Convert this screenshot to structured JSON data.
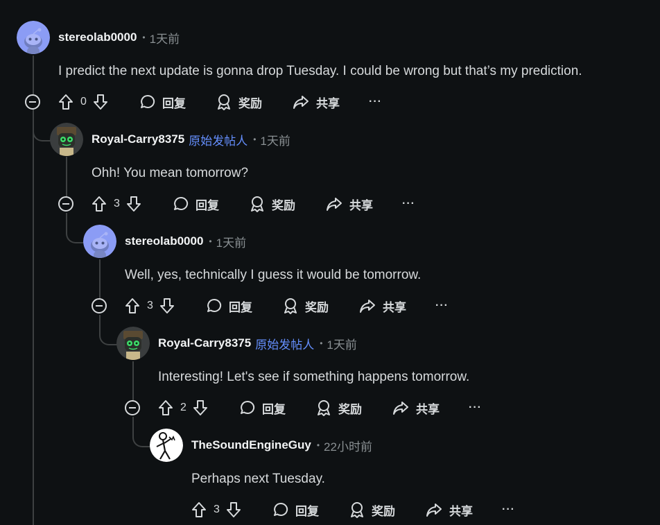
{
  "labels": {
    "reply": "回复",
    "award": "奖励",
    "share": "共享",
    "more": "···"
  },
  "colors": {
    "background": "#0e1113",
    "op_badge": "#648efc",
    "thread_line": "#3e4142",
    "text": "#d7dadc",
    "muted": "#8a9093"
  },
  "comments": [
    {
      "username": "stereolab0000",
      "op_badge": "",
      "time": "1天前",
      "body": "I predict the next update is gonna drop Tuesday. I could be wrong but that’s my prediction.",
      "votes": "0",
      "avatar": "snoo-default-avatar"
    },
    {
      "username": "Royal-Carry8375",
      "op_badge": "原始发帖人",
      "time": "1天前",
      "body": "Ohh! You mean tomorrow?",
      "votes": "3",
      "avatar": "robot-green-eyes-avatar"
    },
    {
      "username": "stereolab0000",
      "op_badge": "",
      "time": "1天前",
      "body": "Well, yes, technically I guess it would be tomorrow.",
      "votes": "3",
      "avatar": "snoo-default-avatar"
    },
    {
      "username": "Royal-Carry8375",
      "op_badge": "原始发帖人",
      "time": "1天前",
      "body": "Interesting! Let's see if something happens tomorrow.",
      "votes": "2",
      "avatar": "robot-green-eyes-avatar"
    },
    {
      "username": "TheSoundEngineGuy",
      "op_badge": "",
      "time": "22小时前",
      "body": "Perhaps next Tuesday.",
      "votes": "3",
      "avatar": "stick-figure-avatar"
    }
  ]
}
